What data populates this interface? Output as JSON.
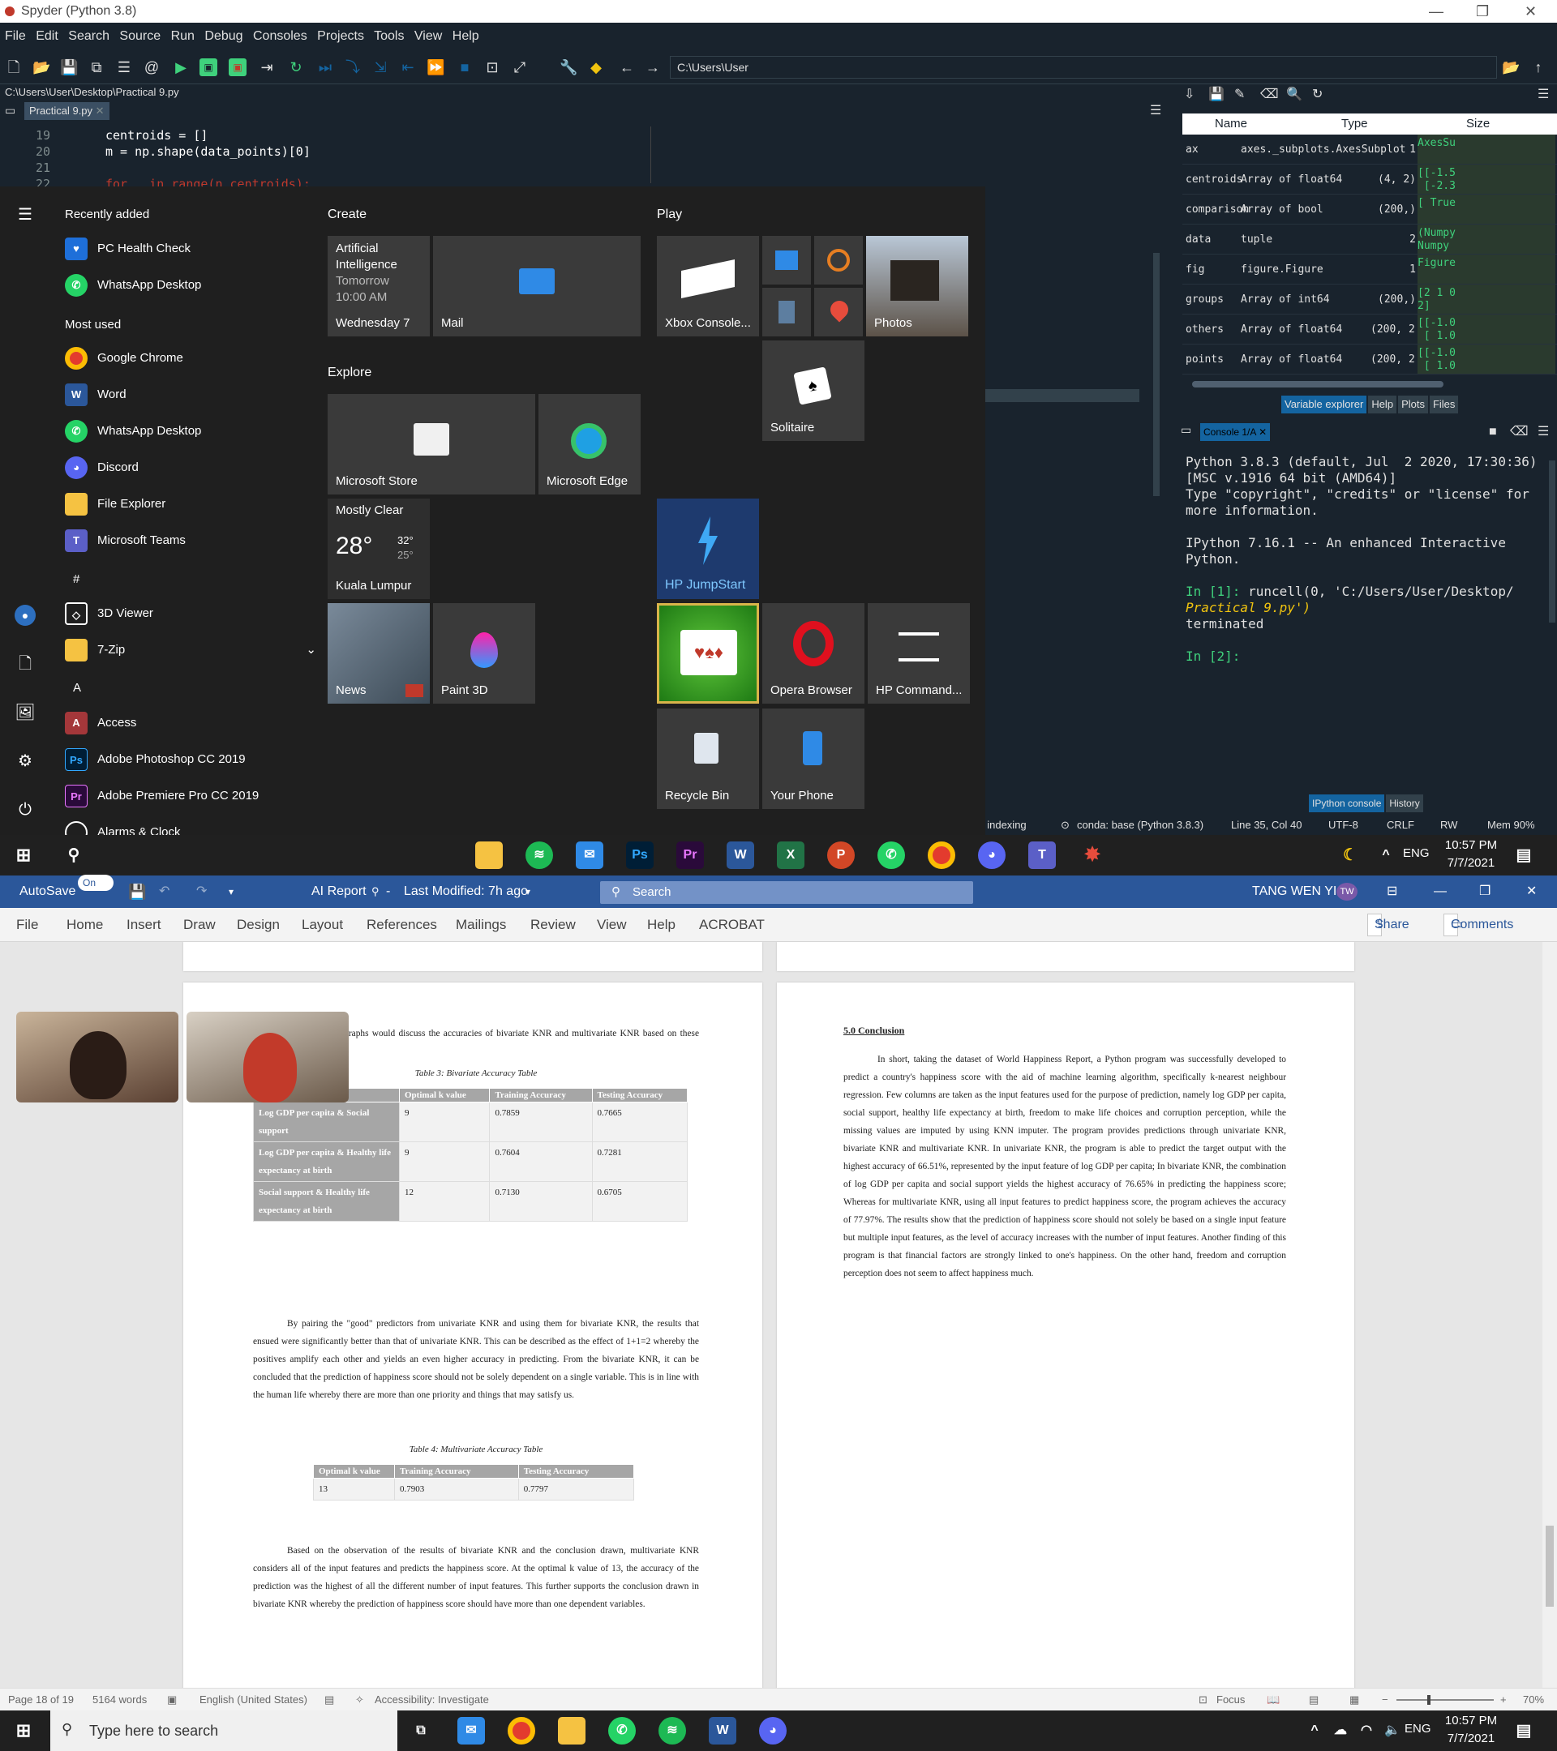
{
  "spyder": {
    "title": "Spyder (Python 3.8)",
    "menu": [
      "File",
      "Edit",
      "Search",
      "Source",
      "Run",
      "Debug",
      "Consoles",
      "Projects",
      "Tools",
      "View",
      "Help"
    ],
    "working_dir": "C:\\Users\\User",
    "file_path": "C:\\Users\\User\\Desktop\\Practical 9.py",
    "editor_tab": "Practical 9.py",
    "code": [
      {
        "ln": "19",
        "text": "centroids = []"
      },
      {
        "ln": "20",
        "text": "m = np.shape(data_points)[0]"
      },
      {
        "ln": "21",
        "text": ""
      },
      {
        "ln": "22",
        "text": "for _ in range(n_centroids):"
      }
    ],
    "var_headers": {
      "name": "Name",
      "type": "Type",
      "size": "Size"
    },
    "variables": [
      {
        "name": "ax",
        "type": "axes._subplots.AxesSubplot",
        "size": "1",
        "value": "AxesSu"
      },
      {
        "name": "centroids",
        "type": "Array of float64",
        "size": "(4, 2)",
        "value": "[[-1.5\n [-2.3"
      },
      {
        "name": "comparison",
        "type": "Array of bool",
        "size": "(200,)",
        "value": "[ True"
      },
      {
        "name": "data",
        "type": "tuple",
        "size": "2",
        "value": "(Numpy\nNumpy"
      },
      {
        "name": "fig",
        "type": "figure.Figure",
        "size": "1",
        "value": "Figure"
      },
      {
        "name": "groups",
        "type": "Array of int64",
        "size": "(200,)",
        "value": "[2 1 0\n2]"
      },
      {
        "name": "others",
        "type": "Array of float64",
        "size": "(200, 2)",
        "value": "[[-1.0\n [ 1.0"
      },
      {
        "name": "points",
        "type": "Array of float64",
        "size": "(200, 2)",
        "value": "[[-1.0\n [ 1.0"
      }
    ],
    "var_tabs": [
      "Variable explorer",
      "Help",
      "Plots",
      "Files"
    ],
    "console_tab": "Console 1/A",
    "console_lines": [
      "Python 3.8.3 (default, Jul  2 2020, 17:30:36)",
      "[MSC v.1916 64 bit (AMD64)]",
      "Type \"copyright\", \"credits\" or \"license\" for",
      "more information.",
      "",
      "IPython 7.16.1 -- An enhanced Interactive",
      "Python.",
      ""
    ],
    "console_in1_prompt": "In [1]:",
    "console_in1_cmd": " runcell(0, 'C:/Users/User/Desktop/",
    "console_in1_cmd2": "Practical 9.py')",
    "console_terminated": "terminated",
    "console_in2_prompt": "In [2]:",
    "console_tabs": [
      "IPython console",
      "History"
    ],
    "status": {
      "indexing": ": indexing",
      "conda": "conda: base (Python 3.8.3)",
      "pos": "Line 35, Col 40",
      "enc": "UTF-8",
      "eol": "CRLF",
      "rw": "RW",
      "mem": "Mem 90%"
    }
  },
  "start_menu": {
    "recently_added_label": "Recently added",
    "recent": [
      "PC Health Check",
      "WhatsApp Desktop"
    ],
    "most_used_label": "Most used",
    "most_used": [
      "Google Chrome",
      "Word",
      "WhatsApp Desktop",
      "Discord",
      "File Explorer",
      "Microsoft Teams"
    ],
    "hash_label": "#",
    "hash_apps": [
      "3D Viewer",
      "7-Zip"
    ],
    "a_label": "A",
    "a_apps": [
      "Access",
      "Adobe Photoshop CC 2019",
      "Adobe Premiere Pro CC 2019",
      "Alarms & Clock"
    ],
    "groups": {
      "create": "Create",
      "explore": "Explore",
      "play": "Play"
    },
    "calendar": {
      "line1": "Artificial",
      "line2": "Intelligence",
      "line3": "Tomorrow",
      "line4": "10:00 AM",
      "day": "Wednesday 7"
    },
    "weather": {
      "condition": "Mostly Clear",
      "temp": "28°",
      "high": "32°",
      "low": "25°",
      "city": "Kuala Lumpur"
    },
    "tiles": {
      "mail": "Mail",
      "xbox": "Xbox Console...",
      "photos": "Photos",
      "solitaire": "Solitaire",
      "store": "Microsoft Store",
      "edge": "Microsoft Edge",
      "hp_jumpstart": "HP JumpStart",
      "news": "News",
      "paint3d": "Paint 3D",
      "opera": "Opera Browser",
      "hp_command": "HP Command...",
      "recycle": "Recycle Bin",
      "your_phone": "Your Phone"
    }
  },
  "taskbar_top": {
    "lang": "ENG",
    "time": "10:57 PM",
    "date": "7/7/2021"
  },
  "word": {
    "autosave": "AutoSave",
    "autosave_state": "On",
    "doc_title": "AI Report",
    "modified": "Last Modified: 7h ago",
    "search": "Search",
    "user": "TANG WEN YI",
    "user_initials": "TW",
    "tabs": [
      "File",
      "Home",
      "Insert",
      "Draw",
      "Design",
      "Layout",
      "References",
      "Mailings",
      "Review",
      "View",
      "Help",
      "ACROBAT"
    ],
    "share": "Share",
    "comments": "Comments",
    "left_page": {
      "intro": "life. The following paragraphs would discuss the accuracies of bivariate KNR and multivariate KNR based on these input features.",
      "table3_caption": "Table 3: Bivariate Accuracy Table",
      "table3_headers": [
        "Input feature",
        "Optimal k value",
        "Training Accuracy",
        "Testing Accuracy"
      ],
      "table3_rows": [
        [
          "Log GDP per capita & Social support",
          "9",
          "0.7859",
          "0.7665"
        ],
        [
          "Log GDP per capita & Healthy life expectancy at birth",
          "9",
          "0.7604",
          "0.7281"
        ],
        [
          "Social support & Healthy life expectancy at birth",
          "12",
          "0.7130",
          "0.6705"
        ]
      ],
      "para2": "By pairing the \"good\" predictors from univariate KNR and using them for bivariate KNR, the results that ensued were significantly better than that of univariate KNR. This can be described as the effect of 1+1=2 whereby the positives amplify each other and yields an even higher accuracy in predicting. From the bivariate KNR, it can be concluded that the prediction of happiness score should not be solely dependent on a single variable. This is in line with the human life whereby there are more than one priority and things that may satisfy us.",
      "table4_caption": "Table 4: Multivariate Accuracy Table",
      "table4_headers": [
        "Optimal k value",
        "Training Accuracy",
        "Testing Accuracy"
      ],
      "table4_rows": [
        [
          "13",
          "0.7903",
          "0.7797"
        ]
      ],
      "para3": "Based on the observation of the results of bivariate KNR and the conclusion drawn, multivariate KNR considers all of the input features and predicts the happiness score. At the optimal k value of 13, the accuracy of the prediction was the highest of all the different number of input features. This further supports the conclusion drawn in bivariate KNR whereby the prediction of happiness score should have more than one dependent variables."
    },
    "right_page": {
      "heading": "5.0 Conclusion",
      "para": "In short, taking the dataset of World Happiness Report, a Python program was successfully developed to predict a country's happiness score with the aid of machine learning algorithm, specifically k-nearest neighbour regression. Few columns are taken as the input features used for the purpose of prediction, namely log GDP per capita, social support, healthy life expectancy at birth, freedom to make life choices and corruption perception, while the missing values are imputed by using KNN imputer. The program provides predictions through univariate KNR, bivariate KNR and multivariate KNR. In univariate KNR, the program is able to predict the target output with the highest accuracy of 66.51%, represented by the input feature of log GDP per capita; In bivariate KNR, the combination of log GDP per capita and social support yields the highest accuracy of 76.65% in predicting the happiness score; Whereas for multivariate KNR, using all input features to predict happiness score, the program achieves the accuracy of 77.97%. The results show that the prediction of happiness score should not solely be based on a single input feature but multiple input features, as the level of accuracy increases with the number of input features. Another finding of this program is that financial factors are strongly linked to one's happiness. On the other hand, freedom and corruption perception does not seem to affect happiness much."
    },
    "status": {
      "page": "Page 18 of 19",
      "words": "5164 words",
      "lang": "English (United States)",
      "access": "Accessibility: Investigate",
      "focus": "Focus",
      "zoom": "70%"
    }
  },
  "taskbar_bottom": {
    "search_placeholder": "Type here to search",
    "lang": "ENG",
    "time": "10:57 PM",
    "date": "7/7/2021"
  },
  "colors": {
    "spyder_bg": "#19232d",
    "word_blue": "#2b579a",
    "start_bg": "#1f1f1f",
    "console_green": "#3fd17c"
  }
}
